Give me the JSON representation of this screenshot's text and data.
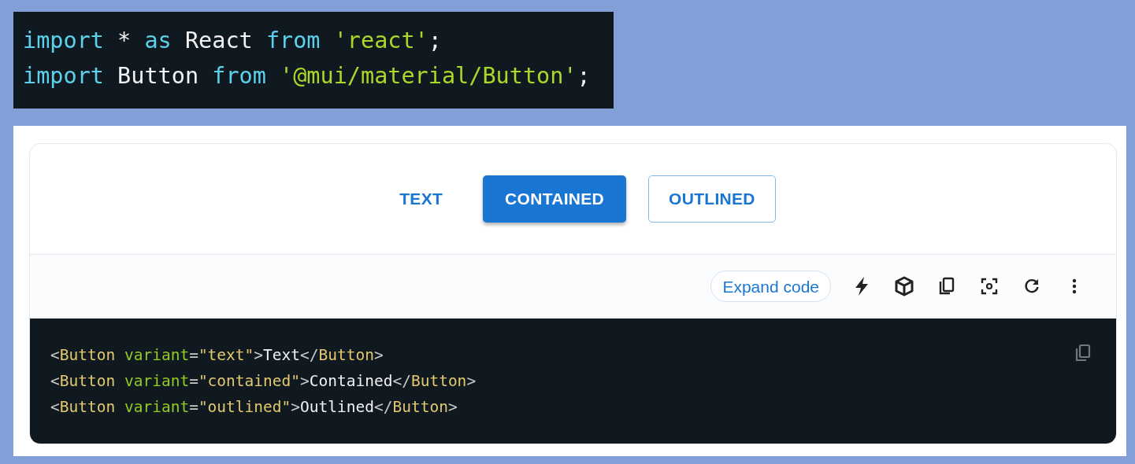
{
  "import_code": [
    [
      {
        "kind": "keyword",
        "text": "import"
      },
      {
        "kind": "plain",
        "text": " * "
      },
      {
        "kind": "keyword",
        "text": "as"
      },
      {
        "kind": "plain",
        "text": " React "
      },
      {
        "kind": "keyword",
        "text": "from "
      },
      {
        "kind": "string",
        "text": "'react'"
      },
      {
        "kind": "plain",
        "text": ";"
      }
    ],
    [
      {
        "kind": "keyword",
        "text": "import"
      },
      {
        "kind": "plain",
        "text": " Button "
      },
      {
        "kind": "keyword",
        "text": "from "
      },
      {
        "kind": "string",
        "text": "'@mui/material/Button'"
      },
      {
        "kind": "plain",
        "text": ";"
      }
    ]
  ],
  "demo_buttons": [
    {
      "kind": "text",
      "label": "TEXT"
    },
    {
      "kind": "contained",
      "label": "CONTAINED"
    },
    {
      "kind": "outlined",
      "label": "OUTLINED"
    }
  ],
  "toolbar": {
    "expand_label": "Expand code"
  },
  "example_code": [
    [
      {
        "kind": "punct",
        "text": "<"
      },
      {
        "kind": "tag",
        "text": "Button "
      },
      {
        "kind": "attr",
        "text": "variant"
      },
      {
        "kind": "punct",
        "text": "="
      },
      {
        "kind": "value",
        "text": "\"text\""
      },
      {
        "kind": "punct",
        "text": ">"
      },
      {
        "kind": "plain",
        "text": "Text"
      },
      {
        "kind": "punct",
        "text": "</"
      },
      {
        "kind": "tag",
        "text": "Button"
      },
      {
        "kind": "punct",
        "text": ">"
      }
    ],
    [
      {
        "kind": "punct",
        "text": "<"
      },
      {
        "kind": "tag",
        "text": "Button "
      },
      {
        "kind": "attr",
        "text": "variant"
      },
      {
        "kind": "punct",
        "text": "="
      },
      {
        "kind": "value",
        "text": "\"contained\""
      },
      {
        "kind": "punct",
        "text": ">"
      },
      {
        "kind": "plain",
        "text": "Contained"
      },
      {
        "kind": "punct",
        "text": "</"
      },
      {
        "kind": "tag",
        "text": "Button"
      },
      {
        "kind": "punct",
        "text": ">"
      }
    ],
    [
      {
        "kind": "punct",
        "text": "<"
      },
      {
        "kind": "tag",
        "text": "Button "
      },
      {
        "kind": "attr",
        "text": "variant"
      },
      {
        "kind": "punct",
        "text": "="
      },
      {
        "kind": "value",
        "text": "\"outlined\""
      },
      {
        "kind": "punct",
        "text": ">"
      },
      {
        "kind": "plain",
        "text": "Outlined"
      },
      {
        "kind": "punct",
        "text": "</"
      },
      {
        "kind": "tag",
        "text": "Button"
      },
      {
        "kind": "punct",
        "text": ">"
      }
    ]
  ]
}
